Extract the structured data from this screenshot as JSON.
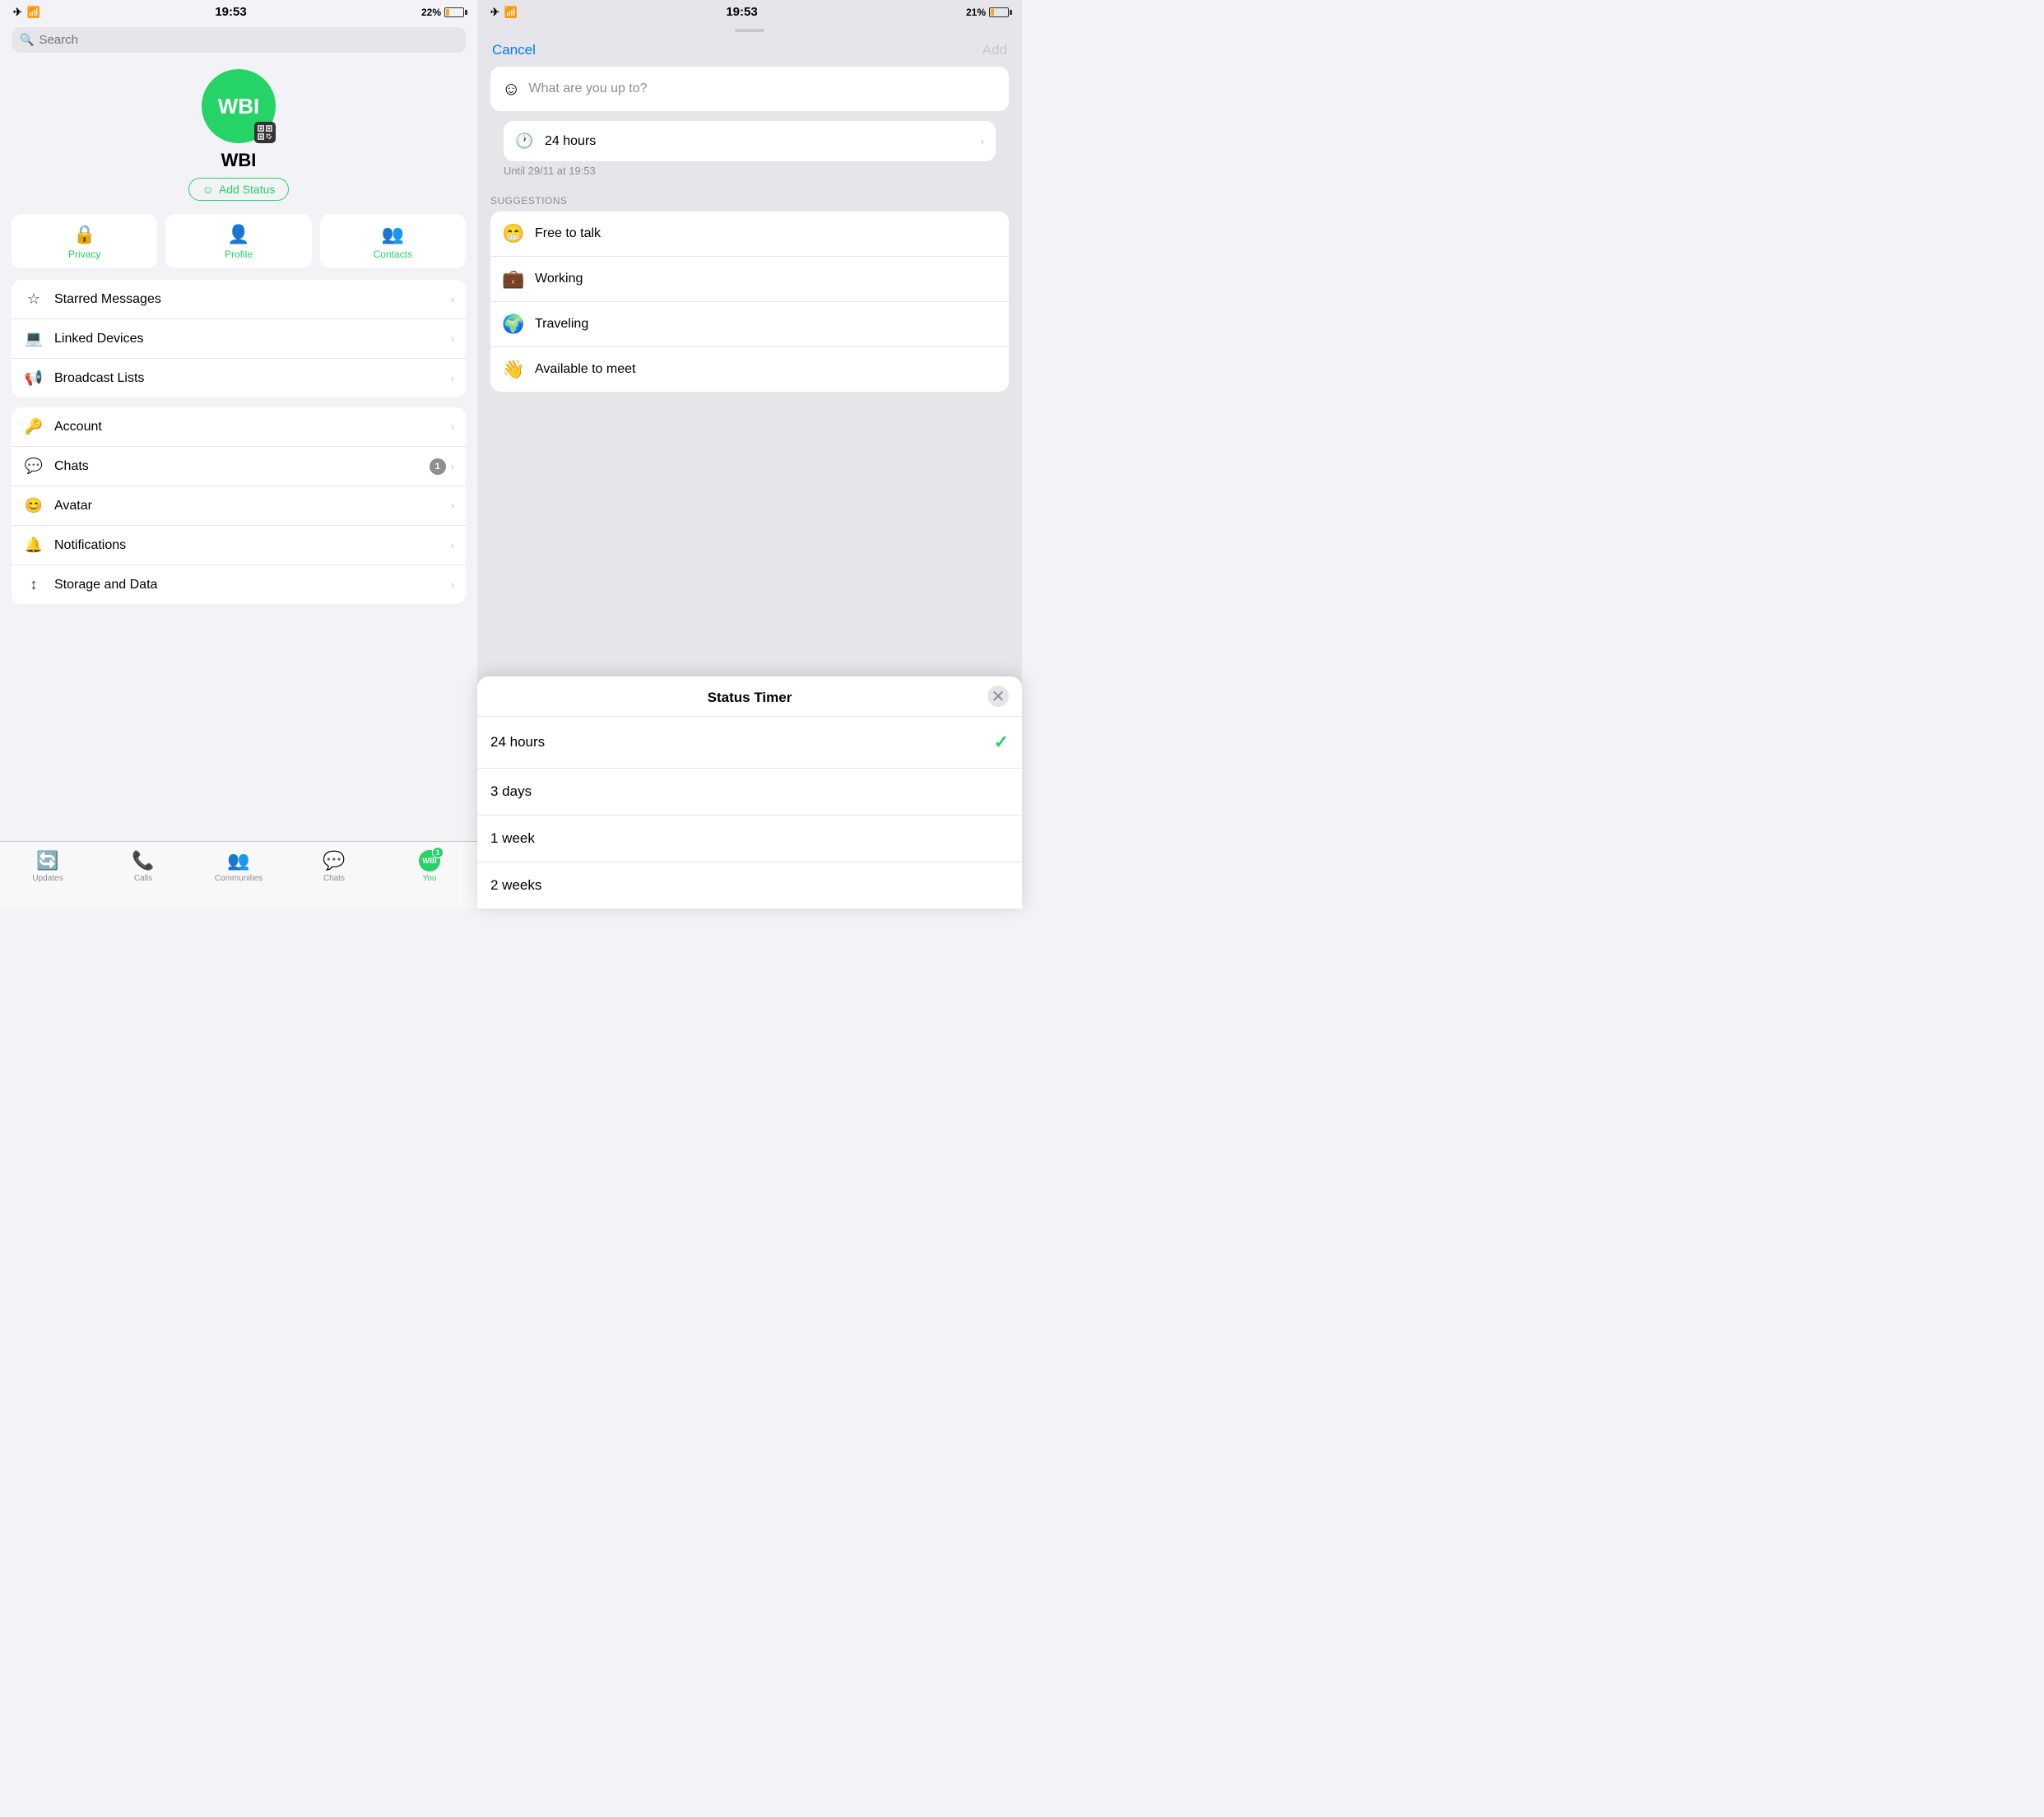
{
  "left": {
    "statusBar": {
      "time": "19:53",
      "battery": "22%"
    },
    "search": {
      "placeholder": "Search"
    },
    "profile": {
      "initials": "WBI",
      "name": "WBI",
      "addStatusLabel": "Add Status"
    },
    "quickActions": [
      {
        "id": "privacy",
        "icon": "🔒",
        "label": "Privacy"
      },
      {
        "id": "profile",
        "icon": "👤",
        "label": "Profile"
      },
      {
        "id": "contacts",
        "icon": "👥",
        "label": "Contacts"
      }
    ],
    "menuGroup1": [
      {
        "id": "starred",
        "icon": "☆",
        "label": "Starred Messages"
      },
      {
        "id": "linked",
        "icon": "□",
        "label": "Linked Devices"
      },
      {
        "id": "broadcast",
        "icon": "📢",
        "label": "Broadcast Lists"
      }
    ],
    "menuGroup2": [
      {
        "id": "account",
        "icon": "🔑",
        "label": "Account",
        "badge": ""
      },
      {
        "id": "chats",
        "icon": "💬",
        "label": "Chats",
        "badge": "1"
      },
      {
        "id": "avatar",
        "icon": "😊",
        "label": "Avatar",
        "badge": ""
      },
      {
        "id": "notifications",
        "icon": "🔔",
        "label": "Notifications",
        "badge": ""
      },
      {
        "id": "storage",
        "icon": "↕",
        "label": "Storage and Data",
        "badge": ""
      }
    ],
    "tabBar": {
      "tabs": [
        {
          "id": "updates",
          "icon": "🔄",
          "label": "Updates",
          "active": false
        },
        {
          "id": "calls",
          "icon": "📞",
          "label": "Calls",
          "active": false
        },
        {
          "id": "communities",
          "icon": "👥",
          "label": "Communities",
          "active": false
        },
        {
          "id": "chats",
          "icon": "💬",
          "label": "Chats",
          "active": false
        },
        {
          "id": "you",
          "label": "You",
          "active": true,
          "initials": "WBI",
          "badge": "1"
        }
      ]
    }
  },
  "right": {
    "statusBar": {
      "time": "19:53",
      "battery": "21%"
    },
    "header": {
      "cancelLabel": "Cancel",
      "addLabel": "Add"
    },
    "statusInput": {
      "placeholder": "What are you up to?"
    },
    "duration": {
      "icon": "🕐",
      "label": "24 hours",
      "note": "Until 29/11 at 19:53"
    },
    "suggestionsHeader": "SUGGESTIONS",
    "suggestions": [
      {
        "emoji": "😁",
        "text": "Free to talk"
      },
      {
        "emoji": "💼",
        "text": "Working"
      },
      {
        "emoji": "🌍",
        "text": "Traveling"
      },
      {
        "emoji": "👋",
        "text": "Available to meet"
      }
    ],
    "timerSheet": {
      "title": "Status Timer",
      "options": [
        {
          "label": "24 hours",
          "selected": true
        },
        {
          "label": "3 days",
          "selected": false
        },
        {
          "label": "1 week",
          "selected": false
        },
        {
          "label": "2 weeks",
          "selected": false
        }
      ]
    }
  }
}
